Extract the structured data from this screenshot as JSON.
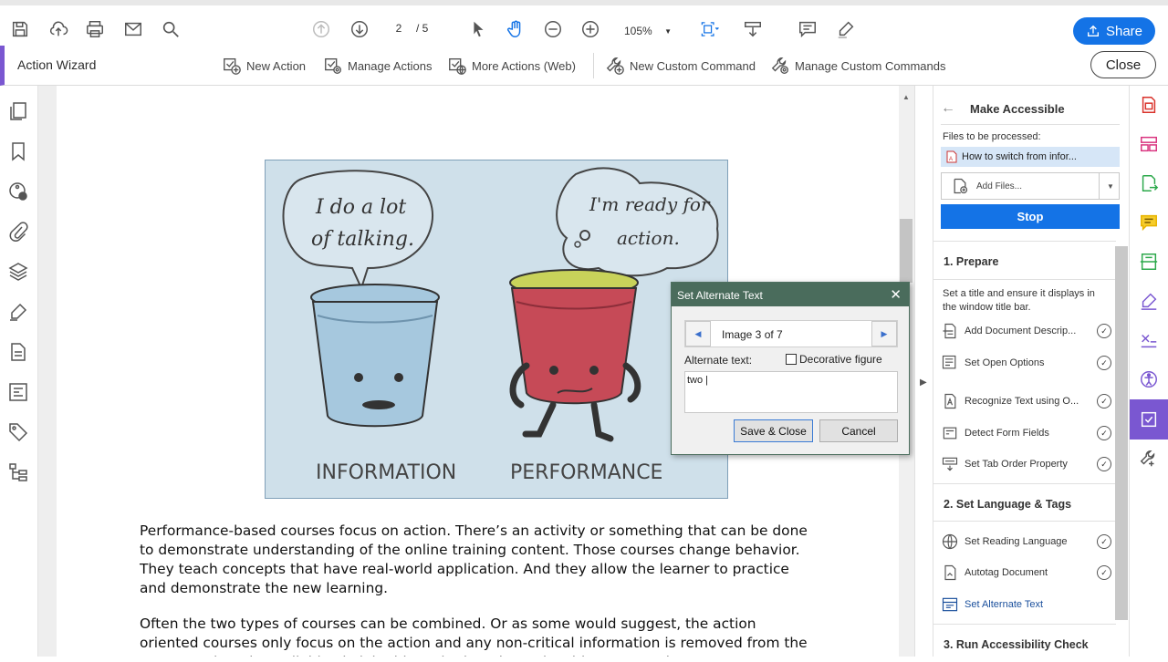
{
  "toolbar": {
    "page_current": "2",
    "page_total": "/ 5",
    "zoom": "105%",
    "share_label": "Share"
  },
  "wizard": {
    "title": "Action Wizard",
    "items": [
      "New Action",
      "Manage Actions",
      "More Actions (Web)",
      "New Custom Command",
      "Manage Custom Commands"
    ],
    "close_label": "Close"
  },
  "document": {
    "illustration": {
      "left_bubble_line1": "I do a lot",
      "left_bubble_line2": "of talking.",
      "right_bubble_line1": "I'm ready for",
      "right_bubble_line2": "action.",
      "left_caption": "INFORMATION",
      "right_caption": "PERFORMANCE"
    },
    "paragraph1": "Performance-based courses focus on action. There’s an activity or something that can be done to demonstrate understanding of the online training content. Those courses change behavior.  They teach concepts that have real-world application. And they allow the learner to practice and demonstrate the new learning.",
    "paragraph2": "Often the two types of courses can be combined. Or as some would suggest, the action oriented courses only focus on the action and any non-critical information is removed from the course and made available via job aids and other channels. Either approach"
  },
  "dialog": {
    "title": "Set Alternate Text",
    "image_counter": "Image 3 of 7",
    "alt_label": "Alternate text:",
    "decorative_label": "Decorative figure",
    "decorative_checked": false,
    "alt_value": "two |",
    "save_label": "Save & Close",
    "cancel_label": "Cancel"
  },
  "panel": {
    "title": "Make Accessible",
    "files_label": "Files to be processed:",
    "file_name": "How to switch from infor...",
    "add_files": "Add Files...",
    "stop_label": "Stop",
    "section1": {
      "title": "1. Prepare",
      "desc": "Set a title and ensure it displays in the window title bar.",
      "items": [
        "Add Document Descrip...",
        "Set Open Options",
        "Recognize Text using O...",
        "Detect Form Fields",
        "Set Tab Order Property"
      ]
    },
    "section2": {
      "title": "2. Set Language & Tags",
      "items": [
        "Set Reading Language",
        "Autotag Document",
        "Set Alternate Text"
      ]
    },
    "section3": {
      "title": "3. Run Accessibility Check"
    }
  },
  "colors": {
    "accent_blue": "#1473e6",
    "wizard_purple": "#7a57d1",
    "dialog_header": "#4a6c5c",
    "illustration_bg": "#cfe0ea"
  }
}
